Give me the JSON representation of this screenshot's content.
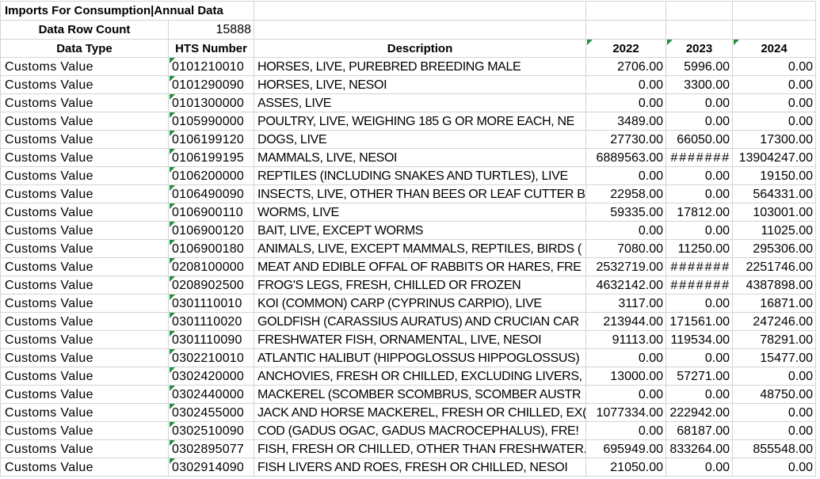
{
  "sheet": {
    "title": "Imports For Consumption|Annual Data",
    "row_count_label": "Data Row Count",
    "row_count_value": "15888",
    "headers": {
      "data_type": "Data Type",
      "hts_number": "HTS Number",
      "description": "Description",
      "y2022": "2022",
      "y2023": "2023",
      "y2024": "2024"
    },
    "rows": [
      {
        "data_type": "Customs Value",
        "hts": "0101210010",
        "description": "HORSES, LIVE, PUREBRED BREEDING MALE",
        "v2022": "2706.00",
        "v2023": "5996.00",
        "v2024": "0.00"
      },
      {
        "data_type": "Customs Value",
        "hts": "0101290090",
        "description": "HORSES, LIVE, NESOI",
        "v2022": "0.00",
        "v2023": "3300.00",
        "v2024": "0.00"
      },
      {
        "data_type": "Customs Value",
        "hts": "0101300000",
        "description": "ASSES, LIVE",
        "v2022": "0.00",
        "v2023": "0.00",
        "v2024": "0.00"
      },
      {
        "data_type": "Customs Value",
        "hts": "0105990000",
        "description": "POULTRY, LIVE, WEIGHING 185 G OR MORE EACH, NE",
        "v2022": "3489.00",
        "v2023": "0.00",
        "v2024": "0.00"
      },
      {
        "data_type": "Customs Value",
        "hts": "0106199120",
        "description": "DOGS, LIVE",
        "v2022": "27730.00",
        "v2023": "66050.00",
        "v2024": "17300.00"
      },
      {
        "data_type": "Customs Value",
        "hts": "0106199195",
        "description": "MAMMALS, LIVE, NESOI",
        "v2022": "6889563.00",
        "v2023": "#######",
        "v2024": "13904247.00"
      },
      {
        "data_type": "Customs Value",
        "hts": "0106200000",
        "description": "REPTILES (INCLUDING SNAKES AND TURTLES), LIVE",
        "v2022": "0.00",
        "v2023": "0.00",
        "v2024": "19150.00"
      },
      {
        "data_type": "Customs Value",
        "hts": "0106490090",
        "description": "INSECTS, LIVE, OTHER THAN BEES OR LEAF CUTTER BI",
        "v2022": "22958.00",
        "v2023": "0.00",
        "v2024": "564331.00"
      },
      {
        "data_type": "Customs Value",
        "hts": "0106900110",
        "description": "WORMS, LIVE",
        "v2022": "59335.00",
        "v2023": "17812.00",
        "v2024": "103001.00"
      },
      {
        "data_type": "Customs Value",
        "hts": "0106900120",
        "description": "BAIT, LIVE, EXCEPT WORMS",
        "v2022": "0.00",
        "v2023": "0.00",
        "v2024": "11025.00"
      },
      {
        "data_type": "Customs Value",
        "hts": "0106900180",
        "description": "ANIMALS, LIVE, EXCEPT MAMMALS, REPTILES, BIRDS (",
        "v2022": "7080.00",
        "v2023": "11250.00",
        "v2024": "295306.00"
      },
      {
        "data_type": "Customs Value",
        "hts": "0208100000",
        "description": "MEAT AND EDIBLE OFFAL OF RABBITS OR HARES, FRE",
        "v2022": "2532719.00",
        "v2023": "#######",
        "v2024": "2251746.00"
      },
      {
        "data_type": "Customs Value",
        "hts": "0208902500",
        "description": "FROG'S LEGS, FRESH, CHILLED OR FROZEN",
        "v2022": "4632142.00",
        "v2023": "#######",
        "v2024": "4387898.00"
      },
      {
        "data_type": "Customs Value",
        "hts": "0301110010",
        "description": "KOI (COMMON) CARP (CYPRINUS CARPIO), LIVE",
        "v2022": "3117.00",
        "v2023": "0.00",
        "v2024": "16871.00"
      },
      {
        "data_type": "Customs Value",
        "hts": "0301110020",
        "description": "GOLDFISH (CARASSIUS AURATUS) AND CRUCIAN CAR",
        "v2022": "213944.00",
        "v2023": "171561.00",
        "v2024": "247246.00"
      },
      {
        "data_type": "Customs Value",
        "hts": "0301110090",
        "description": "FRESHWATER FISH, ORNAMENTAL, LIVE, NESOI",
        "v2022": "91113.00",
        "v2023": "119534.00",
        "v2024": "78291.00"
      },
      {
        "data_type": "Customs Value",
        "hts": "0302210010",
        "description": "ATLANTIC HALIBUT (HIPPOGLOSSUS HIPPOGLOSSUS)",
        "v2022": "0.00",
        "v2023": "0.00",
        "v2024": "15477.00"
      },
      {
        "data_type": "Customs Value",
        "hts": "0302420000",
        "description": "ANCHOVIES, FRESH OR CHILLED, EXCLUDING LIVERS,",
        "v2022": "13000.00",
        "v2023": "57271.00",
        "v2024": "0.00"
      },
      {
        "data_type": "Customs Value",
        "hts": "0302440000",
        "description": "MACKEREL (SCOMBER SCOMBRUS, SCOMBER AUSTR",
        "v2022": "0.00",
        "v2023": "0.00",
        "v2024": "48750.00"
      },
      {
        "data_type": "Customs Value",
        "hts": "0302455000",
        "description": "JACK AND HORSE MACKEREL, FRESH OR CHILLED, EX(",
        "v2022": "1077334.00",
        "v2023": "222942.00",
        "v2024": "0.00"
      },
      {
        "data_type": "Customs Value",
        "hts": "0302510090",
        "description": "COD (GADUS OGAC, GADUS MACROCEPHALUS), FRE!",
        "v2022": "0.00",
        "v2023": "68187.00",
        "v2024": "0.00"
      },
      {
        "data_type": "Customs Value",
        "hts": "0302895077",
        "description": "FISH, FRESH OR CHILLED, OTHER THAN FRESHWATER.",
        "v2022": "695949.00",
        "v2023": "833264.00",
        "v2024": "855548.00"
      },
      {
        "data_type": "Customs Value",
        "hts": "0302914090",
        "description": "FISH LIVERS AND ROES, FRESH OR CHILLED, NESOI",
        "v2022": "21050.00",
        "v2023": "0.00",
        "v2024": "0.00"
      }
    ]
  },
  "colors": {
    "gridline": "#d4d4d4",
    "error_indicator": "#1f8f3a",
    "text": "#000000"
  }
}
